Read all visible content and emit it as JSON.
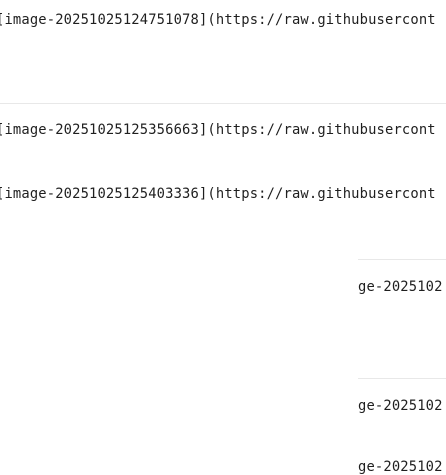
{
  "editor": {
    "lines": [
      "[image-20251025124751078](https://raw.githubusercont",
      "[image-20251025125356663](https://raw.githubusercont",
      "[image-20251025125403336](https://raw.githubusercont"
    ],
    "right_fragments": [
      "ge-2025102",
      "ge-2025102",
      "ge-2025102"
    ]
  }
}
